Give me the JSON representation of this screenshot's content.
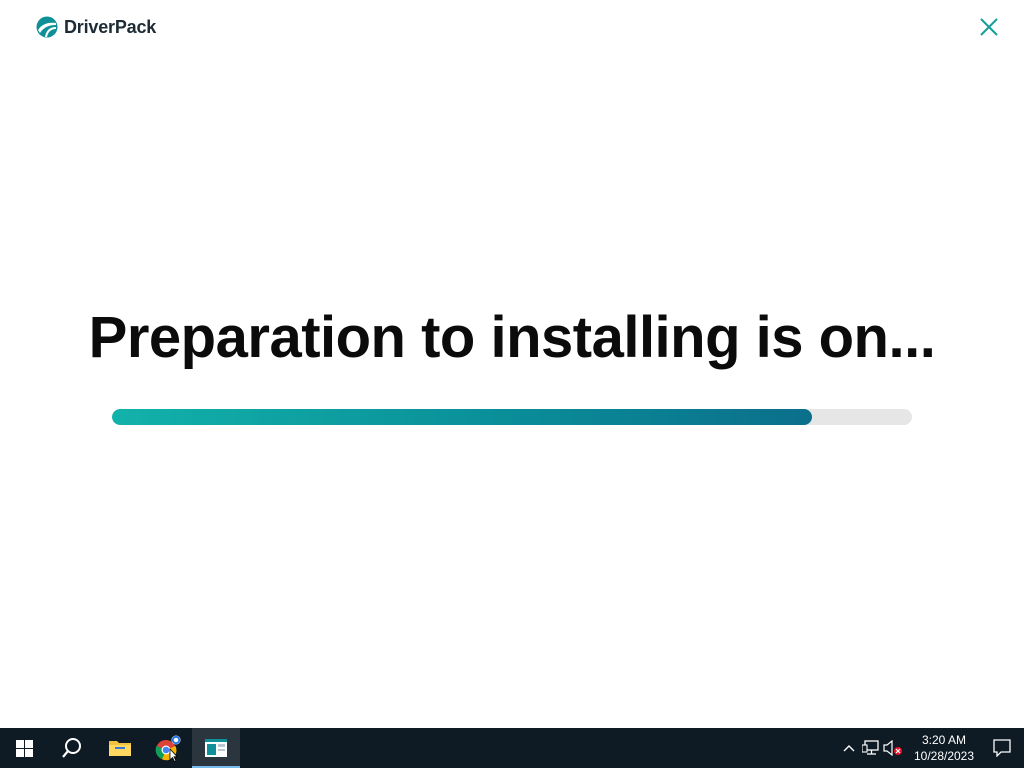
{
  "app": {
    "brand": "DriverPack",
    "heading": "Preparation to installing is on...",
    "progress_fraction": 0.875,
    "accent_start": "#12b2aa",
    "accent_end": "#0b6f8b"
  },
  "taskbar": {
    "items": [
      {
        "icon": "windows-start-icon"
      },
      {
        "icon": "search-icon"
      },
      {
        "icon": "file-explorer-icon"
      },
      {
        "icon": "chrome-icon"
      },
      {
        "icon": "driverpack-app-icon"
      }
    ],
    "tray": {
      "time": "3:20 AM",
      "date": "10/28/2023"
    }
  }
}
